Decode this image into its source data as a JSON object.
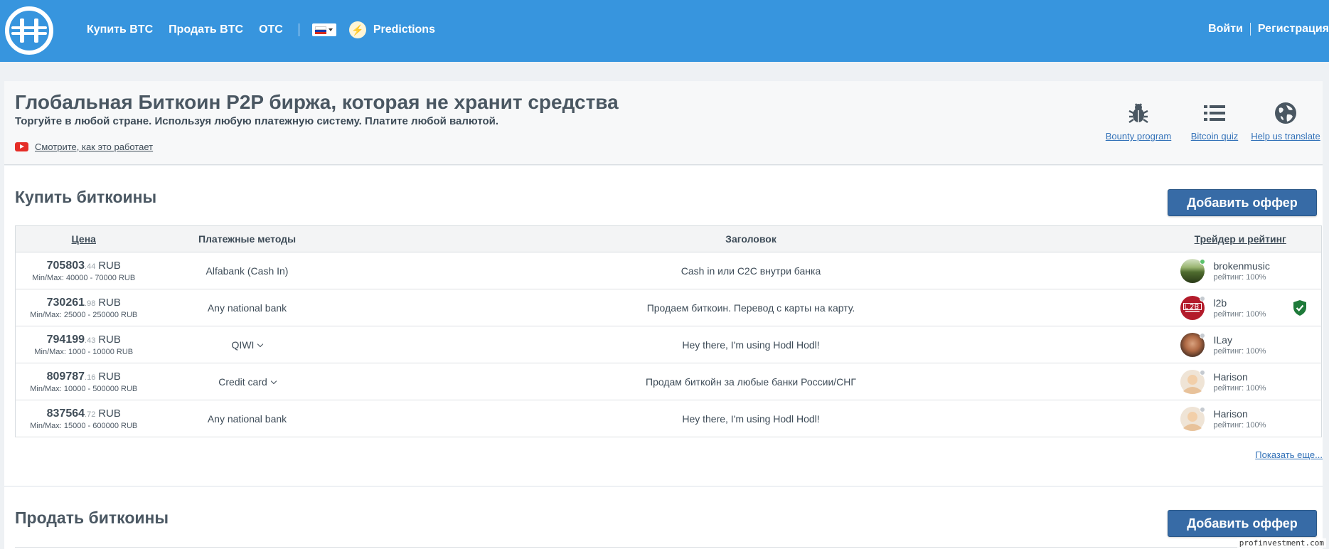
{
  "header": {
    "nav": [
      "Купить BTC",
      "Продать BTC",
      "OTC"
    ],
    "predictions_label": "Predictions",
    "login_label": "Войти",
    "register_label": "Регистрация",
    "colors": {
      "bar": "#3795de"
    }
  },
  "intro": {
    "title": "Глобальная Биткоин P2P биржа, которая не хранит средства",
    "subtitle": "Торгуйте в любой стране. Используя любую платежную систему. Платите любой валютой.",
    "video_link": "Смотрите, как это работает",
    "quick_links": [
      {
        "label": "Bounty program",
        "icon": "bug-icon"
      },
      {
        "label": "Bitcoin quiz",
        "icon": "list-icon"
      },
      {
        "label": "Help us translate",
        "icon": "globe-icon"
      }
    ]
  },
  "buy": {
    "title": "Купить биткоины",
    "add_button": "Добавить оффер",
    "columns": [
      "Цена",
      "Платежные методы",
      "Заголовок",
      "Трейдер и рейтинг"
    ],
    "rows": [
      {
        "price": "705803",
        "cents": ".44",
        "currency": "RUB",
        "minmax": "Min/Max: 40000 - 70000 RUB",
        "method": "Alfabank (Cash In)",
        "method_dropdown": false,
        "title": "Cash in или C2C внутри банка",
        "trader": "brokenmusic",
        "rating": "рейтинг: 100%",
        "online": true,
        "verified": false,
        "avatar": "landscape"
      },
      {
        "price": "730261",
        "cents": ".98",
        "currency": "RUB",
        "minmax": "Min/Max: 25000 - 250000 RUB",
        "method": "Any national bank",
        "method_dropdown": false,
        "title": "Продаем биткоин. Перевод с карты на карту.",
        "trader": "l2b",
        "rating": "рейтинг: 100%",
        "online": false,
        "verified": true,
        "avatar": "l2b"
      },
      {
        "price": "794199",
        "cents": ".43",
        "currency": "RUB",
        "minmax": "Min/Max: 1000 - 10000 RUB",
        "method": "QIWI",
        "method_dropdown": true,
        "title": "Hey there, I'm using Hodl Hodl!",
        "trader": "ILay",
        "rating": "рейтинг: 100%",
        "online": false,
        "verified": false,
        "avatar": "photo"
      },
      {
        "price": "809787",
        "cents": ".16",
        "currency": "RUB",
        "minmax": "Min/Max: 10000 - 500000 RUB",
        "method": "Credit card",
        "method_dropdown": true,
        "title": "Продам биткойн за любые банки России/СНГ",
        "trader": "Harison",
        "rating": "рейтинг: 100%",
        "online": false,
        "verified": false,
        "avatar": "default"
      },
      {
        "price": "837564",
        "cents": ".72",
        "currency": "RUB",
        "minmax": "Min/Max: 15000 - 600000 RUB",
        "method": "Any national bank",
        "method_dropdown": false,
        "title": "Hey there, I'm using Hodl Hodl!",
        "trader": "Harison",
        "rating": "рейтинг: 100%",
        "online": false,
        "verified": false,
        "avatar": "default"
      }
    ],
    "show_more": "Показать еще..."
  },
  "sell": {
    "title": "Продать биткоины",
    "add_button": "Добавить оффер"
  },
  "watermark": "profinvestment.com"
}
